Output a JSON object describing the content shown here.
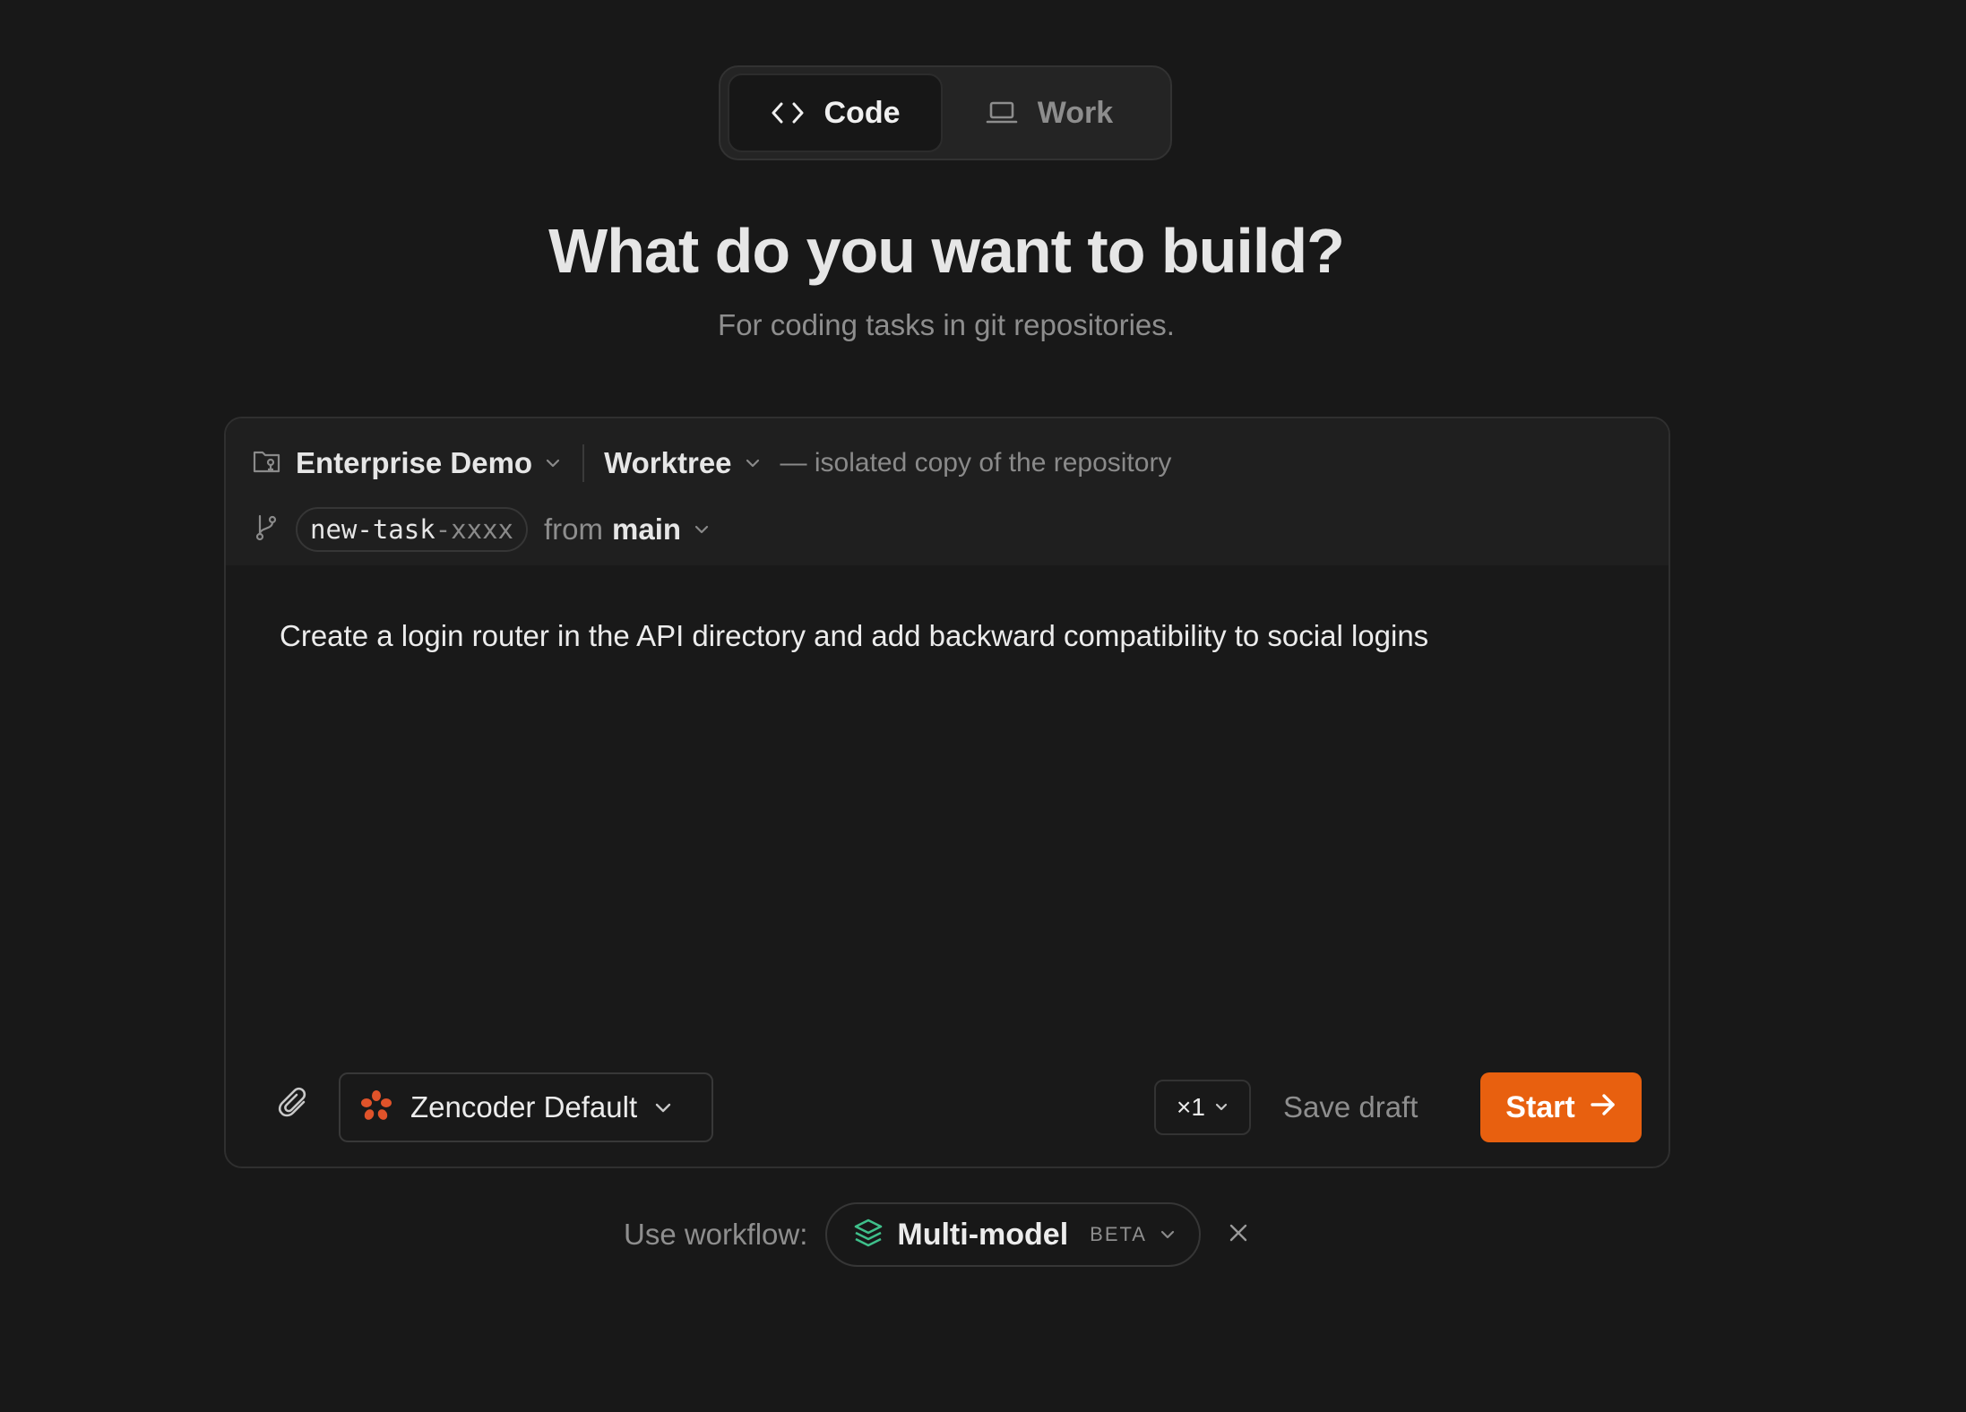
{
  "mode_switch": {
    "tabs": [
      {
        "label": "Code",
        "icon": "code-brackets-icon",
        "active": true
      },
      {
        "label": "Work",
        "icon": "laptop-icon",
        "active": false
      }
    ]
  },
  "hero": {
    "title": "What do you want to build?",
    "subtitle": "For coding tasks in git repositories."
  },
  "composer": {
    "repository": {
      "icon": "folder-repo-icon",
      "name": "Enterprise Demo"
    },
    "workspace": {
      "mode": "Worktree",
      "hint": "— isolated copy of the repository"
    },
    "branch": {
      "icon": "git-branch-icon",
      "new_branch_prefix": "new-task",
      "new_branch_suffix": "-xxxx",
      "from_label": "from",
      "base": "main"
    },
    "prompt": "Create a login router in the API directory and add backward compatibility to social logins",
    "toolbar": {
      "attach_icon": "paperclip-icon",
      "agent": {
        "icon": "zencoder-logo-icon",
        "label": "Zencoder Default"
      },
      "count": "×1",
      "save_draft": "Save draft",
      "start": "Start",
      "accent_color": "#e8600f"
    }
  },
  "workflow": {
    "label": "Use workflow:",
    "name": "Multi-model",
    "badge": "BETA",
    "icon": "layers-icon",
    "icon_color": "#3fbf8a"
  }
}
